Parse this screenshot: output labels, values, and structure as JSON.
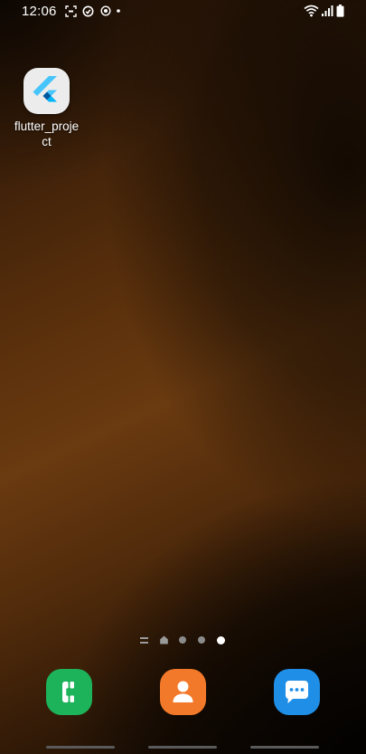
{
  "status_bar": {
    "time": "12:06",
    "left_icons": [
      "screenshot-icon",
      "sync-icon",
      "data-saver-icon",
      "notification-dot-icon"
    ],
    "right_icons": [
      "wifi-icon",
      "signal-icon",
      "battery-icon"
    ]
  },
  "home": {
    "apps": [
      {
        "label": "flutter_project",
        "icon": "flutter-icon"
      }
    ]
  },
  "page_indicator": {
    "items": [
      "menu-pages",
      "home-page",
      "page-2",
      "page-3",
      "page-4"
    ],
    "active_index": 4
  },
  "dock": {
    "apps": [
      {
        "name": "Phone",
        "icon": "phone-icon",
        "color": "#1db35a"
      },
      {
        "name": "Contacts",
        "icon": "contact-icon",
        "color": "#f3792a"
      },
      {
        "name": "Messages",
        "icon": "chat-bubble-icon",
        "color": "#1f8ee6"
      }
    ]
  },
  "nav_bar": {
    "buttons": [
      "recent-apps",
      "home",
      "back"
    ]
  }
}
